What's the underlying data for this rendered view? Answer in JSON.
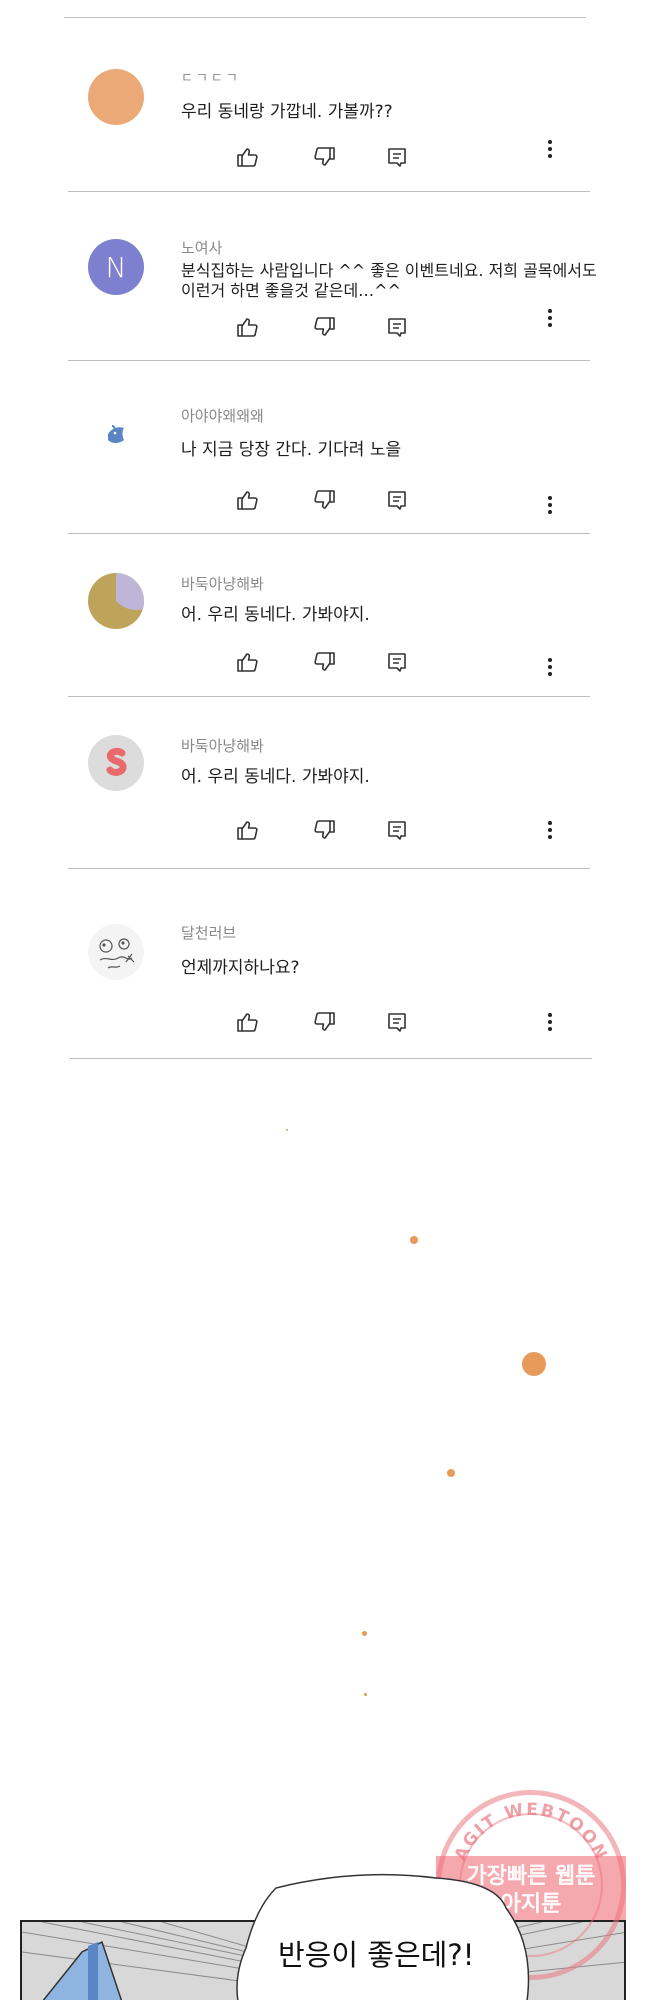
{
  "comments": [
    {
      "username": "ㄷㄱㄷㄱ",
      "text_lines": [
        "우리 동네랑 가깝네. 가볼까??"
      ],
      "avatar": "peach-circle"
    },
    {
      "username": "노여사",
      "text_lines": [
        "분식집하는 사람입니다 ^^ 좋은 이벤트네요. 저희 골목에서도",
        "이런거 하면 좋을것 같은데…^^"
      ],
      "avatar": "letter-n",
      "avatar_letter": "N"
    },
    {
      "username": "아야야왜왜왜",
      "text_lines": [
        "나 지금 당장 간다. 기다려 노을"
      ],
      "avatar": "blue-bird"
    },
    {
      "username": "바둑아냥해봐",
      "text_lines": [
        "어. 우리 동네다. 가봐야지."
      ],
      "avatar": "olive-pie"
    },
    {
      "username": "바둑아냥해봐",
      "text_lines": [
        "어. 우리 동네다. 가봐야지."
      ],
      "avatar": "red-squiggle"
    },
    {
      "username": "달천러브",
      "text_lines": [
        "언제까지하나요?"
      ],
      "avatar": "sketch-doodle"
    }
  ],
  "icons": {
    "like": "thumbs-up-icon",
    "dislike": "thumbs-down-icon",
    "reply": "reply-icon",
    "more": "more-vertical-icon"
  },
  "colors": {
    "orange_dot": "#e89a5a",
    "avatar_peach": "#eba978",
    "avatar_purple": "#7d7fcf",
    "avatar_olive": "#bea45a",
    "avatar_lilac": "#bdb6d8",
    "stamp_pink": "#ee6e78"
  },
  "watermark": {
    "arc_text": "AGIT WEBTOON",
    "line1": "가장빠른 웹툰",
    "line2": "아지툰"
  },
  "speech_bubble": {
    "text": "반응이 좋은데?!"
  }
}
